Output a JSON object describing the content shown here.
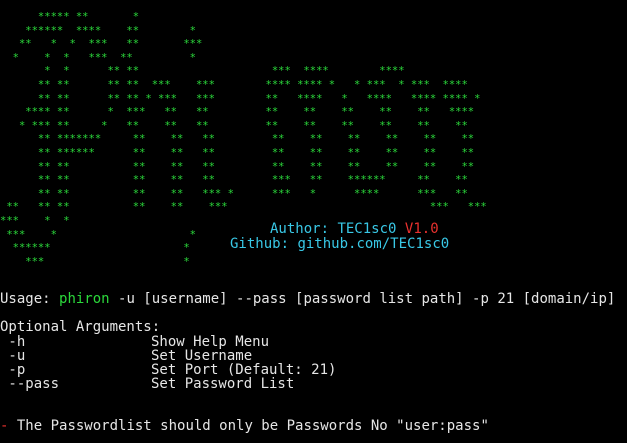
{
  "banner": {
    "art_lines": [
      "      ***** **       *",
      "    ******  ****    **        *",
      "   **   *  *  ***   **       ***",
      "  *    *  *   ***  **         *",
      "       *  *      ** **                     ***  ****        ****",
      "      ** **      ** **  ***    ***        **** **** *   * ***  * ***  ****",
      "      ** **      ** ** * ***   ***        **   ****   *   ****   **** **** *",
      "    **** **      *  ***   **   **         **    **    **    **    **   ****",
      "   * *** **     *   **    **   **         **    **    **    **    **    **",
      "      ** *******     **    **   **         **    **    **    **    **    **",
      "      ** ******      **    **   **         **    **    **    **    **    **",
      "      ** **          **    **   **         **    **    **    **    **    **",
      "      ** **          **    **   **         ***   **    ******     **    **",
      "      ** **          **    **   *** *      ***   *      ****      ***   **",
      " **   ** **          **    **    ***                                ***   ***",
      "***    *  *",
      " ***    *                     *",
      "  ******                     *",
      "    ***                      *"
    ],
    "author_label": "Author:",
    "author_value": "TEC1sc0",
    "version": "V1.0",
    "github_label": "Github:",
    "github_value": "github.com/TEC1sc0"
  },
  "usage": {
    "prefix": "Usage: ",
    "command": "phiron",
    "args": " -u [username] --pass [password list path] -p 21 [domain/ip]"
  },
  "optional": {
    "heading": "Optional Arguments:",
    "args": [
      {
        "flag": " -h",
        "desc": "Show Help Menu"
      },
      {
        "flag": " -u",
        "desc": "Set Username"
      },
      {
        "flag": " -p",
        "desc": "Set Port (Default: 21)"
      },
      {
        "flag": " --pass",
        "desc": "Set Password List"
      }
    ]
  },
  "note": {
    "marker": "-",
    "text": " The Passwordlist should only be Passwords No \"user:pass\""
  }
}
